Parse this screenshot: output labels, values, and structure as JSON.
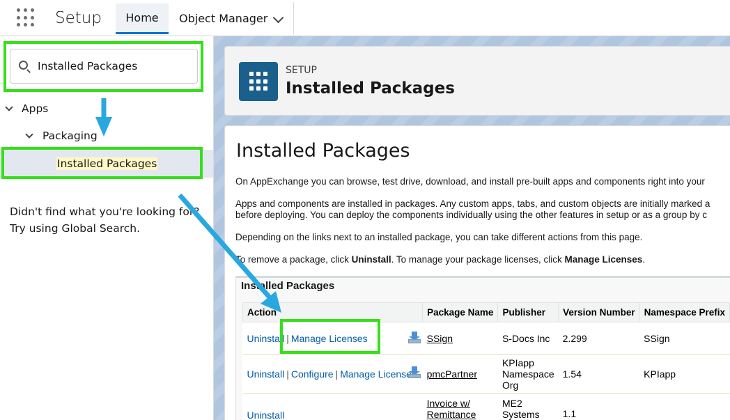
{
  "topbar": {
    "app_title": "Setup",
    "tabs": [
      {
        "label": "Home"
      },
      {
        "label": "Object Manager"
      }
    ]
  },
  "sidebar": {
    "search": {
      "value": "Installed Packages"
    },
    "tree": {
      "apps": "Apps",
      "packaging": "Packaging",
      "installed_packages": "Installed Packages"
    },
    "help_line1": "Didn't find what you're looking for?",
    "help_line2": "Try using Global Search."
  },
  "header": {
    "eyebrow": "SETUP",
    "title": "Installed Packages"
  },
  "content": {
    "title": "Installed Packages",
    "para1": "On AppExchange you can browse, test drive, download, and install pre-built apps and components right into your",
    "para2a": "Apps and components are installed in packages. Any custom apps, tabs, and custom objects are initially marked a",
    "para2b": "before deploying. You can deploy the components individually using the other features in setup or as a group by c",
    "para3": "Depending on the links next to an installed package, you can take different actions from this page.",
    "para4_prefix": "To remove a package, click ",
    "para4_uninstall": "Uninstall",
    "para4_middle": ". To manage your package licenses, click ",
    "para4_manage": "Manage Licenses",
    "para4_suffix": "."
  },
  "packages": {
    "section_title": "Installed Packages",
    "columns": [
      "Action",
      "Package Name",
      "Publisher",
      "Version Number",
      "Namespace Prefix"
    ],
    "link_labels": {
      "uninstall": "Uninstall",
      "configure": "Configure",
      "manage_licenses": "Manage Licenses"
    },
    "rows": [
      {
        "name": "SSign",
        "publisher": "S-Docs Inc",
        "version": "2.299",
        "namespace": "SSign"
      },
      {
        "name": "pmcPartner",
        "publisher": "KPIapp Namespace Org",
        "version": "1.54",
        "namespace": "KPIapp"
      },
      {
        "name": "Invoice w/ Remittance",
        "publisher": "ME2 Systems",
        "version": "1.1",
        "namespace": ""
      }
    ]
  },
  "colors": {
    "annotation_box": "#35e01a",
    "annotation_arrow": "#29a8e0",
    "link": "#015ba7",
    "header_icon": "#1b5f8c"
  }
}
